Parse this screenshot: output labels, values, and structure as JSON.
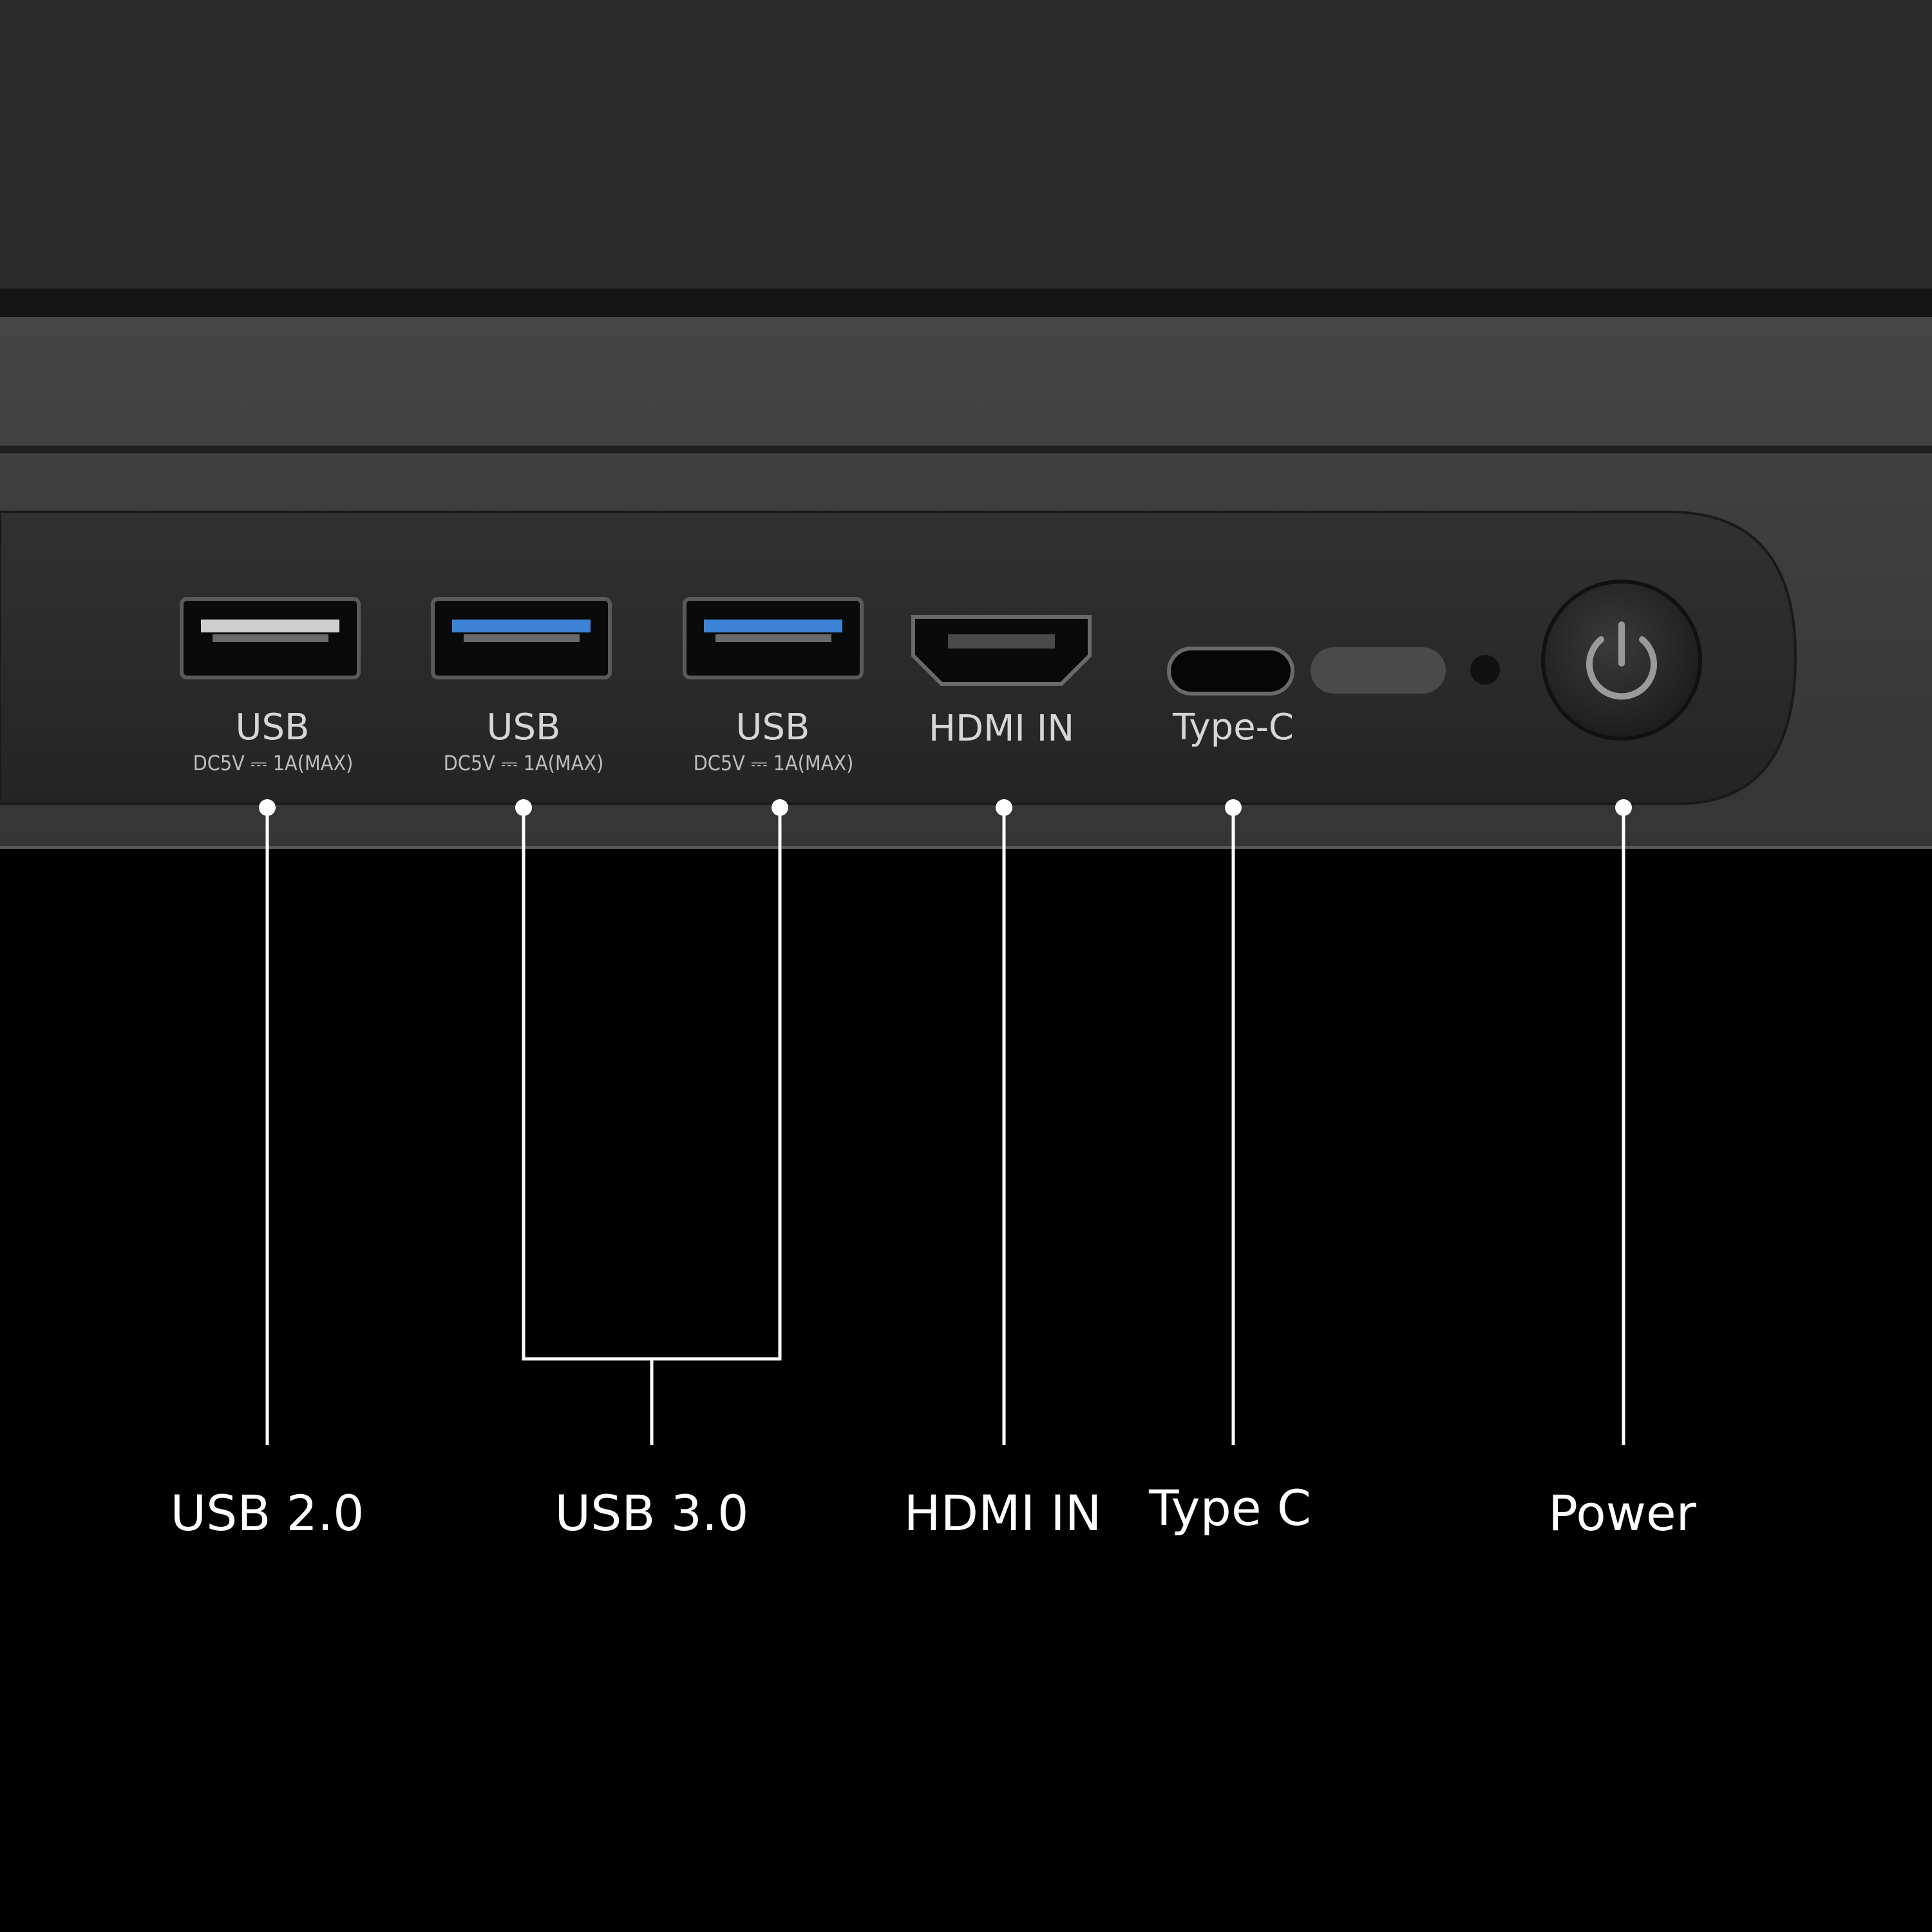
{
  "colors": {
    "background": "#000000",
    "screen_top": "#2a2a2a",
    "frame": "#3c3c3d",
    "panel": "#2b2b2c",
    "usb3_blue": "#3d83d6",
    "usb2_white": "#cfcfcf",
    "line": "#ffffff"
  },
  "ports": [
    {
      "label": "USB",
      "spec": "DC5V ⎓ 1A(MAX)",
      "icon": "usb-2-port-icon"
    },
    {
      "label": "USB",
      "spec": "DC5V ⎓ 1A(MAX)",
      "icon": "usb-3-port-icon"
    },
    {
      "label": "USB",
      "spec": "DC5V ⎓ 1A(MAX)",
      "icon": "usb-3-port-icon"
    },
    {
      "label": "HDMI IN",
      "spec": "",
      "icon": "hdmi-port-icon"
    },
    {
      "label": "Type-C",
      "spec": "",
      "icon": "usb-c-port-icon"
    }
  ],
  "callouts": {
    "usb2": "USB 2.0",
    "usb3": "USB 3.0",
    "hdmi": "HDMI IN",
    "typec": "Type C",
    "power": "Power"
  },
  "icons": {
    "power": "power-button-icon",
    "sensor": "light-sensor-icon",
    "led": "indicator-led-icon"
  }
}
